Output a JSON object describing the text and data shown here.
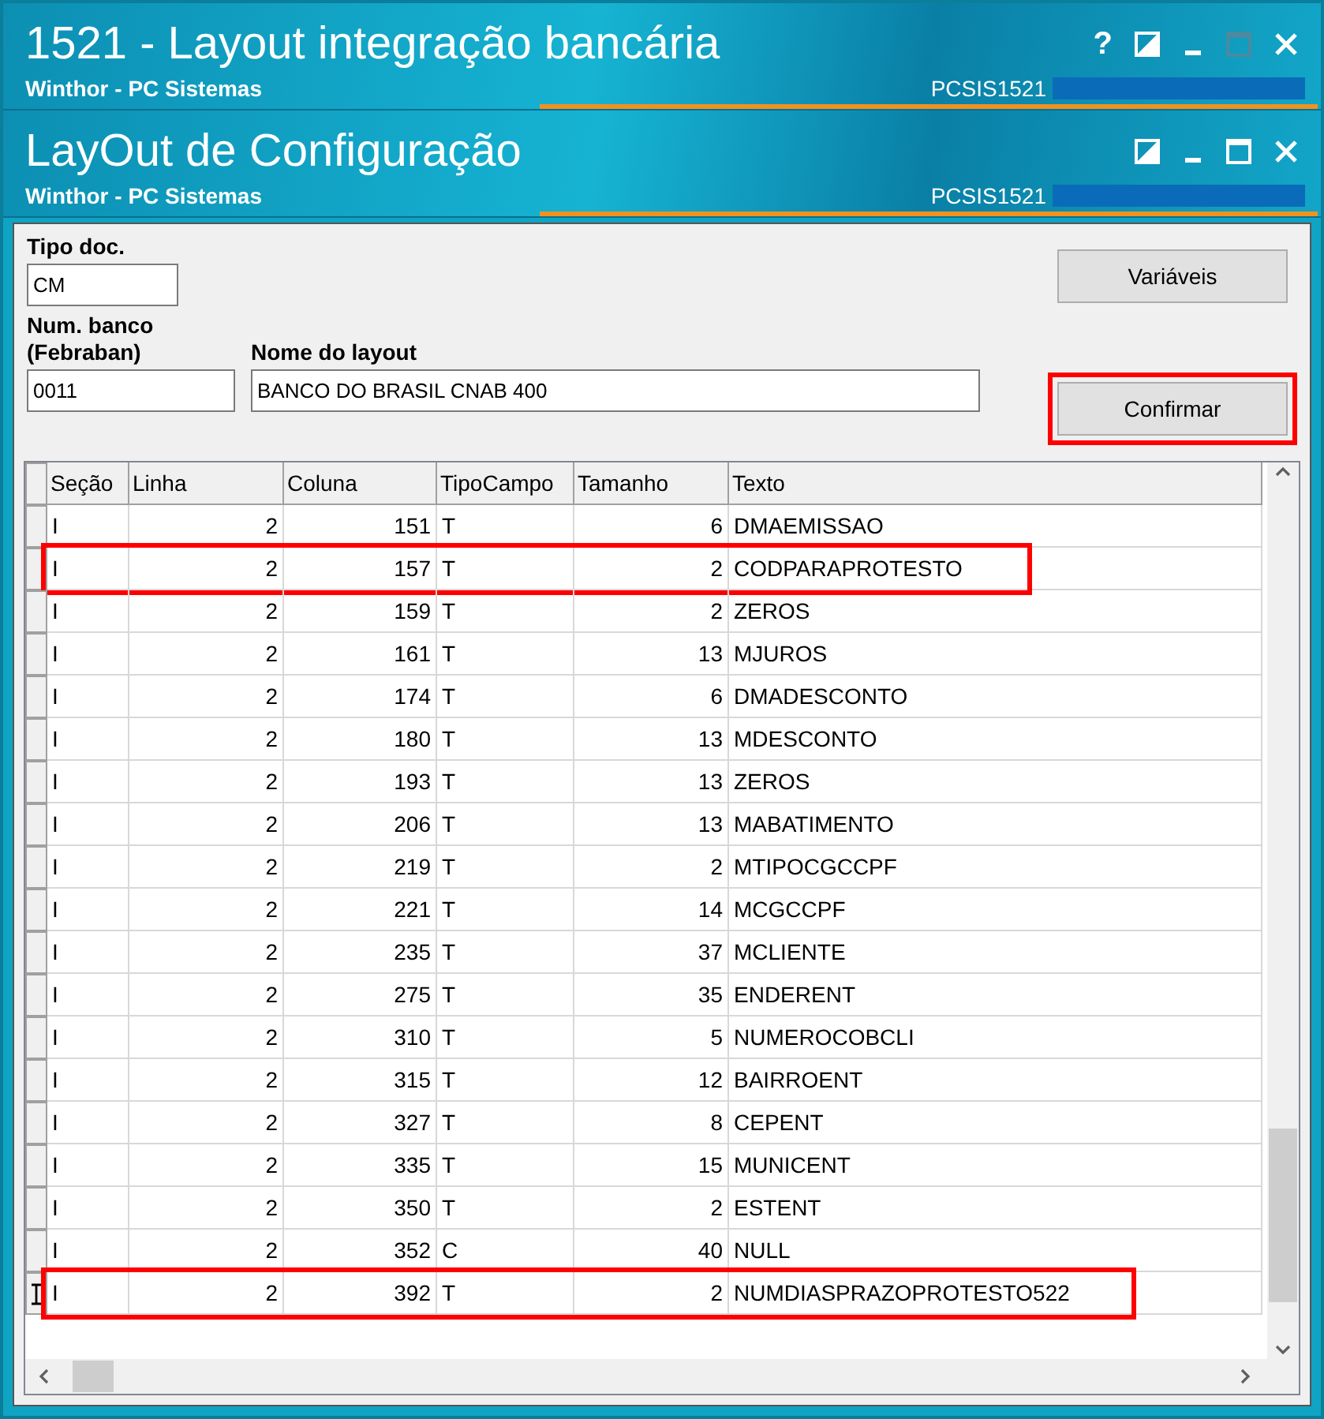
{
  "windows": [
    {
      "title": "1521 - Layout integração bancária",
      "subtitle": "Winthor - PC Sistemas",
      "code": "PCSIS1521",
      "help": "?",
      "maximize_disabled": true
    },
    {
      "title": "LayOut de Configuração",
      "subtitle": "Winthor - PC Sistemas",
      "code": "PCSIS1521",
      "maximize_disabled": false
    }
  ],
  "form": {
    "tipo_doc": {
      "label": "Tipo doc.",
      "value": "CM"
    },
    "num_banco": {
      "label": "Num. banco\n(Febraban)",
      "value": "0011"
    },
    "nome_layout": {
      "label": "Nome do layout",
      "value": "BANCO DO BRASIL CNAB 400"
    },
    "buttons": [
      {
        "label": "Variáveis",
        "highlighted": false
      },
      {
        "label": "Confirmar",
        "highlighted": true
      }
    ]
  },
  "table": {
    "columns": [
      "Seção",
      "Linha",
      "Coluna",
      "TipoCampo",
      "Tamanho",
      "Texto"
    ],
    "rows": [
      {
        "cells": [
          "I",
          "2",
          "151",
          "T",
          "6",
          "DMAEMISSAO"
        ],
        "highlighted": false,
        "current": false
      },
      {
        "cells": [
          "I",
          "2",
          "157",
          "T",
          "2",
          "CODPARAPROTESTO"
        ],
        "highlighted": true,
        "current": false
      },
      {
        "cells": [
          "I",
          "2",
          "159",
          "T",
          "2",
          "ZEROS"
        ],
        "highlighted": false,
        "current": false
      },
      {
        "cells": [
          "I",
          "2",
          "161",
          "T",
          "13",
          "MJUROS"
        ],
        "highlighted": false,
        "current": false
      },
      {
        "cells": [
          "I",
          "2",
          "174",
          "T",
          "6",
          "DMADESCONTO"
        ],
        "highlighted": false,
        "current": false
      },
      {
        "cells": [
          "I",
          "2",
          "180",
          "T",
          "13",
          "MDESCONTO"
        ],
        "highlighted": false,
        "current": false
      },
      {
        "cells": [
          "I",
          "2",
          "193",
          "T",
          "13",
          "ZEROS"
        ],
        "highlighted": false,
        "current": false
      },
      {
        "cells": [
          "I",
          "2",
          "206",
          "T",
          "13",
          "MABATIMENTO"
        ],
        "highlighted": false,
        "current": false
      },
      {
        "cells": [
          "I",
          "2",
          "219",
          "T",
          "2",
          "MTIPOCGCCPF"
        ],
        "highlighted": false,
        "current": false
      },
      {
        "cells": [
          "I",
          "2",
          "221",
          "T",
          "14",
          "MCGCCPF"
        ],
        "highlighted": false,
        "current": false
      },
      {
        "cells": [
          "I",
          "2",
          "235",
          "T",
          "37",
          "MCLIENTE"
        ],
        "highlighted": false,
        "current": false
      },
      {
        "cells": [
          "I",
          "2",
          "275",
          "T",
          "35",
          "ENDERENT"
        ],
        "highlighted": false,
        "current": false
      },
      {
        "cells": [
          "I",
          "2",
          "310",
          "T",
          "5",
          "NUMEROCOBCLI"
        ],
        "highlighted": false,
        "current": false
      },
      {
        "cells": [
          "I",
          "2",
          "315",
          "T",
          "12",
          "BAIRROENT"
        ],
        "highlighted": false,
        "current": false
      },
      {
        "cells": [
          "I",
          "2",
          "327",
          "T",
          "8",
          "CEPENT"
        ],
        "highlighted": false,
        "current": false
      },
      {
        "cells": [
          "I",
          "2",
          "335",
          "T",
          "15",
          "MUNICENT"
        ],
        "highlighted": false,
        "current": false
      },
      {
        "cells": [
          "I",
          "2",
          "350",
          "T",
          "2",
          "ESTENT"
        ],
        "highlighted": false,
        "current": false
      },
      {
        "cells": [
          "I",
          "2",
          "352",
          "C",
          "40",
          "NULL"
        ],
        "highlighted": false,
        "current": false
      },
      {
        "cells": [
          "I",
          "2",
          "392",
          "T",
          "2",
          "NUMDIASPRAZOPROTESTO522"
        ],
        "highlighted": true,
        "current": true
      }
    ]
  }
}
